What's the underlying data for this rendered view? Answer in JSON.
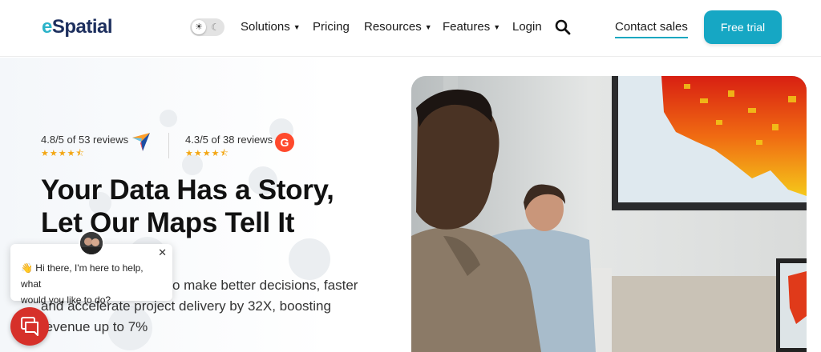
{
  "header": {
    "logo_e": "e",
    "logo_rest": "Spatial",
    "theme_toggle": {
      "light_icon": "sun-icon",
      "dark_icon": "moon-icon",
      "sun_glyph": "☀",
      "moon_glyph": "☾"
    },
    "nav": [
      {
        "label": "Solutions",
        "has_caret": true
      },
      {
        "label": "Pricing",
        "has_caret": false
      },
      {
        "label": "Resources",
        "has_caret": true
      },
      {
        "label": "Features",
        "has_caret": true
      },
      {
        "label": "Login",
        "has_caret": false
      }
    ],
    "caret_glyph": "▼",
    "search_icon": "search-icon",
    "contact_label": "Contact sales",
    "trial_label": "Free trial"
  },
  "hero": {
    "reviews": [
      {
        "text": "4.8/5 of 53 reviews",
        "stars": "★★★★⯪",
        "rating": 4.8,
        "icon": "capterra-logo-icon"
      },
      {
        "text": "4.3/5 of 38 reviews",
        "stars": "★★★★⯪",
        "rating": 4.3,
        "icon": "g2-logo-icon",
        "icon_text": "G"
      }
    ],
    "headline_line1": "Your Data Has a Story,",
    "headline_line2": "Let Our Maps Tell It",
    "subtext_line1": "y to make better decisions, faster",
    "subtext_line2": "and accelerate project delivery by 32X, boosting",
    "subtext_line3": "revenue up to 7%"
  },
  "chat": {
    "message_line1": "👋 Hi there, I'm here to help, what",
    "message_line2": "would you like to do?",
    "close_glyph": "✕",
    "launcher_icon": "chat-icon"
  },
  "colors": {
    "brand_teal": "#16a7c4",
    "brand_navy": "#1d2f5e",
    "star_gold": "#f3a613",
    "chat_red": "#d6302a",
    "g2_orange": "#ff492c"
  }
}
